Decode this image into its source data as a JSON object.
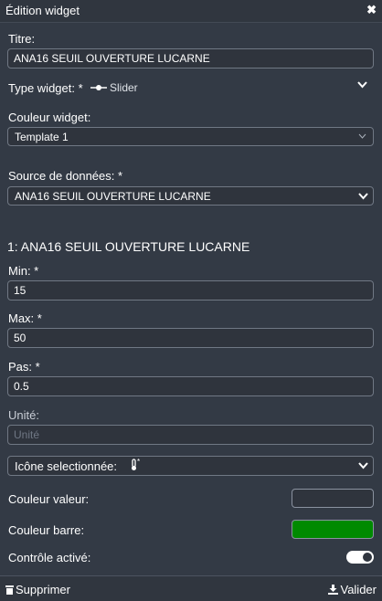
{
  "header": {
    "title": "Édition widget",
    "close_icon": "close-icon"
  },
  "title_field": {
    "label": "Titre:",
    "value": "ANA16 SEUIL OUVERTURE LUCARNE"
  },
  "type_widget": {
    "label": "Type widget: *",
    "value": "Slider",
    "icon": "slider-icon"
  },
  "couleur_widget": {
    "label": "Couleur widget:",
    "value": "Template 1"
  },
  "source": {
    "label": "Source de données: *",
    "value": "ANA16 SEUIL OUVERTURE LUCARNE"
  },
  "section_title": "1: ANA16 SEUIL OUVERTURE LUCARNE",
  "min": {
    "label": "Min: *",
    "value": "15"
  },
  "max": {
    "label": "Max: *",
    "value": "50"
  },
  "pas": {
    "label": "Pas: *",
    "value": "0.5"
  },
  "unite": {
    "label": "Unité:",
    "value": "",
    "placeholder": "Unité"
  },
  "icone": {
    "label": "Icône selectionnée:",
    "icon": "thermometer-icon"
  },
  "couleur_valeur": {
    "label": "Couleur valeur:",
    "color": "#2f343d"
  },
  "couleur_barre": {
    "label": "Couleur barre:",
    "color": "#008a00"
  },
  "controle": {
    "label": "Contrôle activé:",
    "enabled": true
  },
  "footer": {
    "delete_label": "Supprimer",
    "validate_label": "Valider"
  }
}
